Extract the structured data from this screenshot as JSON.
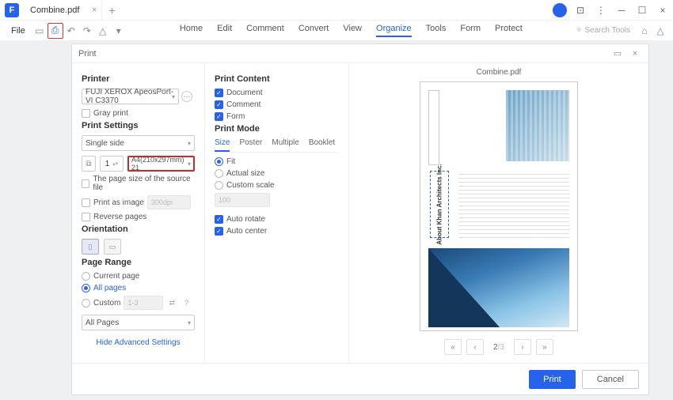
{
  "titlebar": {
    "tab": "Combine.pdf",
    "logo_glyph": "F"
  },
  "file_menu": "File",
  "ribbon": {
    "items": [
      "Home",
      "Edit",
      "Comment",
      "Convert",
      "View",
      "Organize",
      "Tools",
      "Form",
      "Protect"
    ],
    "active": "Organize",
    "search_placeholder": "Search Tools"
  },
  "dialog": {
    "title": "Print",
    "printer": {
      "heading": "Printer",
      "selected": "FUJI XEROX ApeosPort-VI C3370",
      "gray": "Gray print"
    },
    "settings": {
      "heading": "Print Settings",
      "sides": "Single side",
      "copies": "1",
      "paper": "A4(210x297mm) 21",
      "src_size": "The page size of the source file",
      "as_image": "Print as image",
      "as_image_hint": "300dpi",
      "reverse": "Reverse pages"
    },
    "orientation": {
      "heading": "Orientation"
    },
    "page_range": {
      "heading": "Page Range",
      "current": "Current page",
      "all": "All pages",
      "custom": "Custom",
      "custom_hint": "1-3",
      "subset": "All Pages"
    },
    "content": {
      "heading": "Print Content",
      "doc": "Document",
      "comment": "Comment",
      "form": "Form"
    },
    "mode": {
      "heading": "Print Mode",
      "tabs": [
        "Size",
        "Poster",
        "Multiple",
        "Booklet"
      ],
      "fit": "Fit",
      "actual": "Actual size",
      "custom_scale": "Custom scale",
      "scale_hint": "100",
      "auto_rotate": "Auto rotate",
      "auto_center": "Auto center"
    },
    "advanced": "Hide Advanced Settings",
    "preview": {
      "filename": "Combine.pdf",
      "annotation": "About Khan Architects Inc.",
      "page": "2",
      "total": "/3"
    },
    "actions": {
      "print": "Print",
      "cancel": "Cancel"
    }
  }
}
